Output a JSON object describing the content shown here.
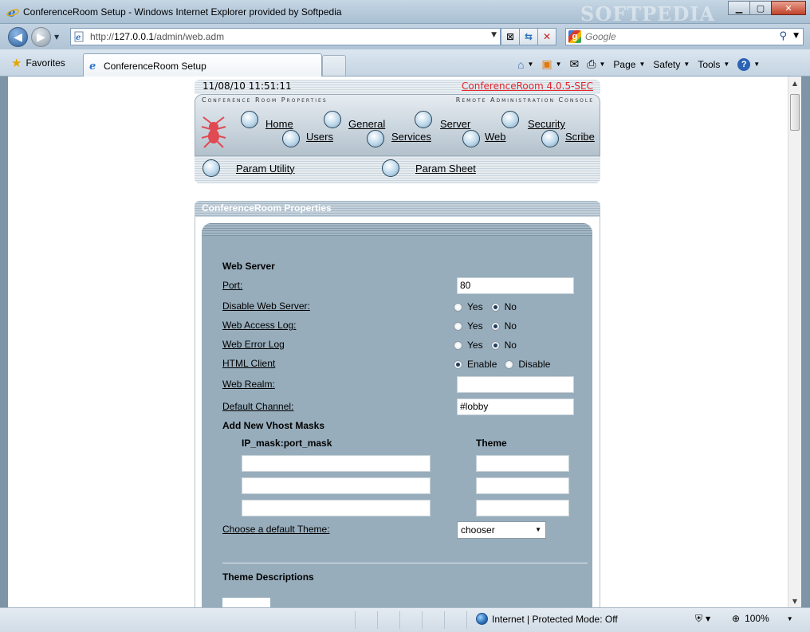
{
  "window": {
    "title": "ConferenceRoom Setup - Windows Internet Explorer provided by Softpedia",
    "watermark": "SOFTPEDIA",
    "minimize": "▁",
    "maximize": "▢",
    "close": "✕"
  },
  "toolbar": {
    "url_prefix": "http://",
    "url_host": "127.0.0.1",
    "url_path": "/admin/web.adm",
    "search_placeholder": "Google",
    "favorites_label": "Favorites",
    "tab_label": "ConferenceRoom Setup",
    "commands": {
      "page": "Page",
      "safety": "Safety",
      "tools": "Tools",
      "help": "?"
    }
  },
  "header": {
    "datetime": "11/08/10 11:51:11",
    "version": "ConferenceRoom 4.0.5-SEC",
    "label_left": "Conference Room Properties",
    "label_right": "Remote Administration Console",
    "nav_row1": [
      "Home",
      "General",
      "Server",
      "Security"
    ],
    "nav_row2": [
      "Users",
      "Services",
      "Web",
      "Scribe"
    ],
    "nav_row3": [
      "Param Utility",
      "Param Sheet"
    ]
  },
  "props": {
    "title": "ConferenceRoom Properties",
    "section": "Web Server",
    "port_label": "Port:",
    "port_value": "80",
    "disable_label": "Disable Web Server:",
    "access_log_label": "Web Access Log:",
    "error_log_label": "Web Error Log",
    "html_client_label": "HTML Client",
    "yes": "Yes",
    "no": "No",
    "enable": "Enable",
    "disable": "Disable",
    "realm_label": "Web Realm:",
    "realm_value": "",
    "channel_label": "Default Channel:",
    "channel_value": "#lobby",
    "vhost_title": "Add New Vhost Masks",
    "ipmask_header": "IP_mask:port_mask",
    "theme_header": "Theme",
    "theme_label": "Choose a default Theme:",
    "theme_value": "chooser",
    "theme_desc_title": "Theme Descriptions"
  },
  "status": {
    "zone": "Internet | Protected Mode: Off",
    "zoom": "100%"
  },
  "colors": {
    "accent_red": "#e0242a",
    "panel": "#97adbc"
  }
}
